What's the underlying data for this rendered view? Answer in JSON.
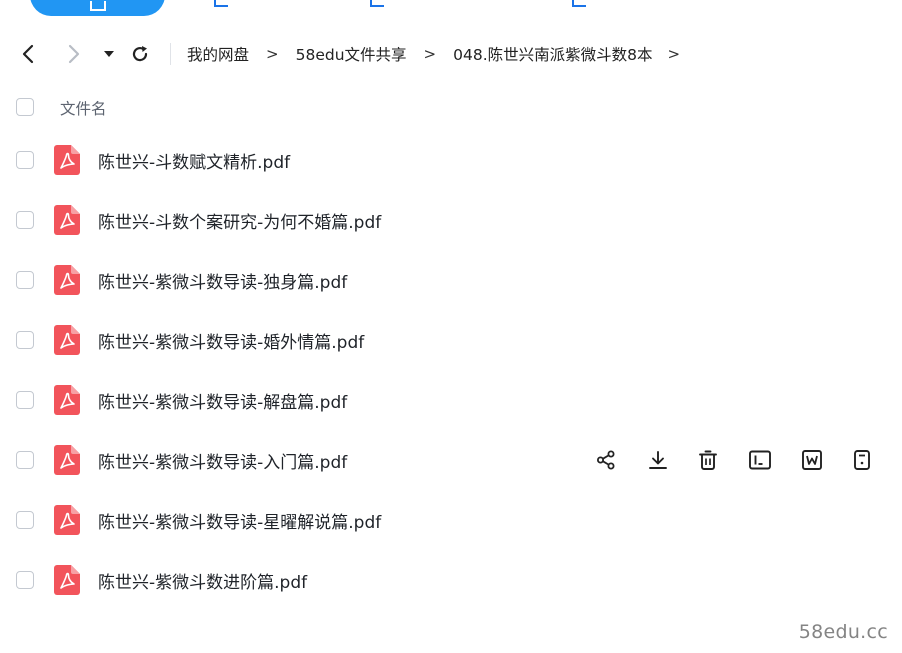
{
  "toolbar": {
    "icons": [
      "upload-icon",
      "new-folder-icon",
      "sync-icon",
      "device-icon"
    ]
  },
  "nav": {
    "back_icon": "chevron-left-icon",
    "forward_icon": "chevron-right-icon",
    "history_icon": "caret-down-icon",
    "refresh_icon": "refresh-icon"
  },
  "breadcrumb": {
    "items": [
      "我的网盘",
      "58edu文件共享",
      "048.陈世兴南派紫微斗数8本"
    ],
    "separator": ">"
  },
  "list_header": {
    "filename_label": "文件名"
  },
  "files": [
    {
      "name": "陈世兴-斗数赋文精析.pdf"
    },
    {
      "name": "陈世兴-斗数个案研究-为何不婚篇.pdf"
    },
    {
      "name": "陈世兴-紫微斗数导读-独身篇.pdf"
    },
    {
      "name": "陈世兴-紫微斗数导读-婚外情篇.pdf"
    },
    {
      "name": "陈世兴-紫微斗数导读-解盘篇.pdf"
    },
    {
      "name": "陈世兴-紫微斗数导读-入门篇.pdf",
      "hovered": true
    },
    {
      "name": "陈世兴-紫微斗数导读-星曜解说篇.pdf"
    },
    {
      "name": "陈世兴-紫微斗数进阶篇.pdf"
    }
  ],
  "row_actions": [
    "share-icon",
    "download-icon",
    "delete-icon",
    "rename-icon",
    "word-convert-icon",
    "more-icon"
  ],
  "watermark": "58edu.cc",
  "colors": {
    "accent": "#2196f3",
    "pdf_red": "#f2545b",
    "text": "#1f2329",
    "muted": "#5d6470"
  }
}
